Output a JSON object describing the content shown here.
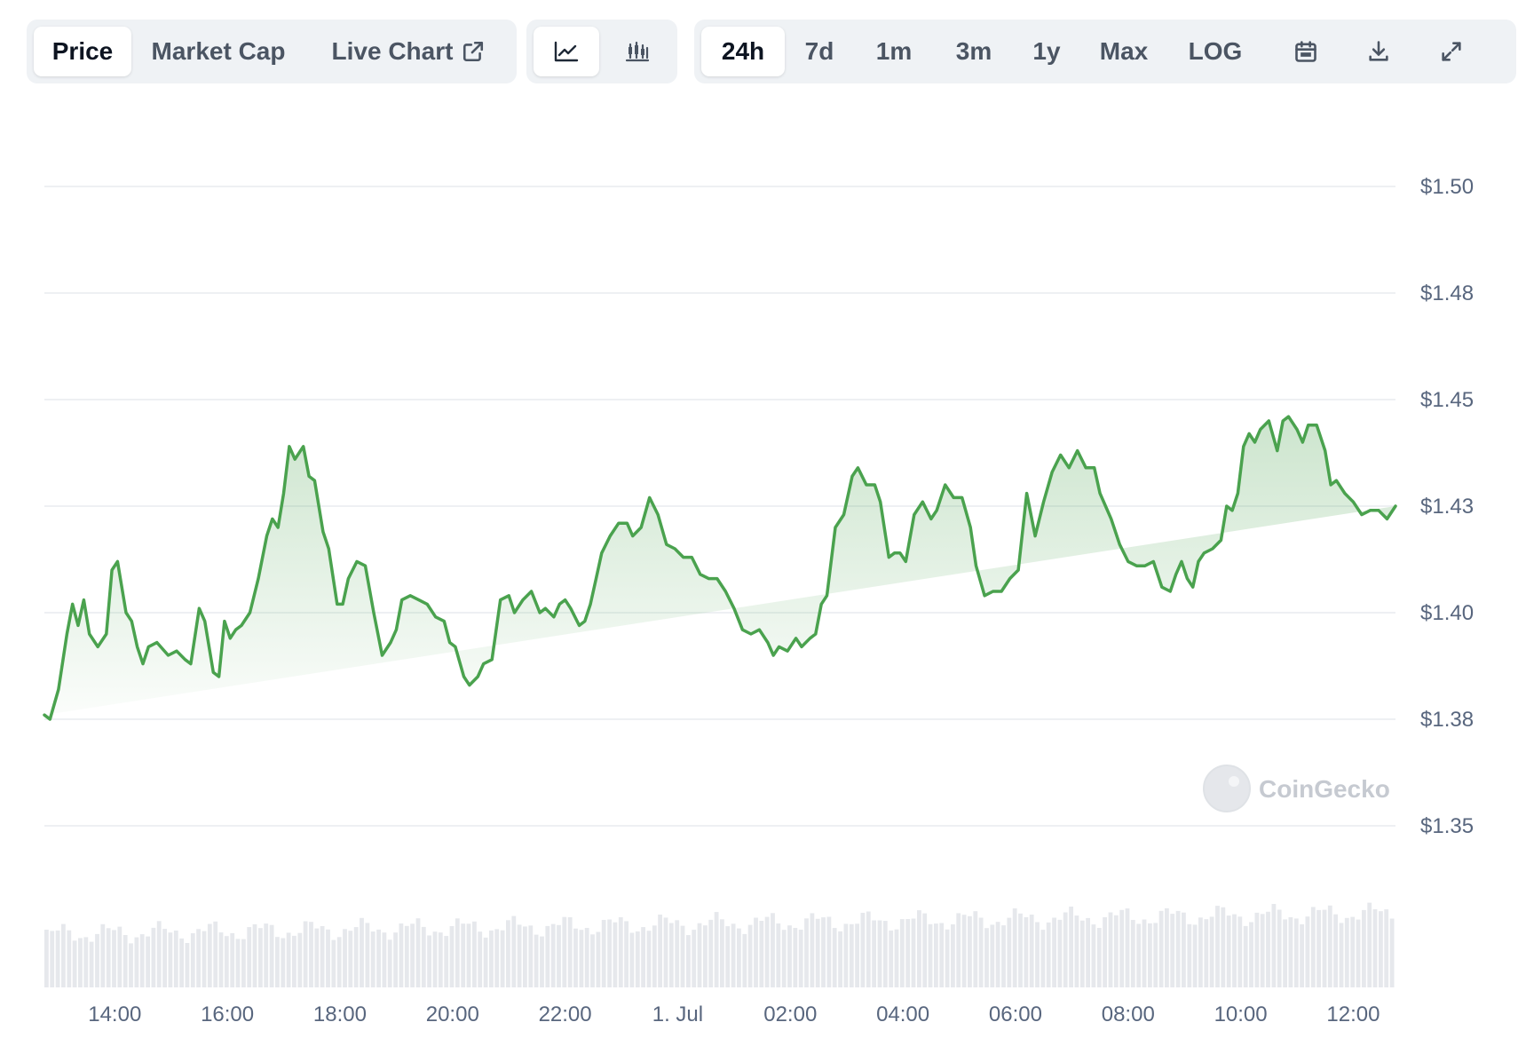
{
  "toolbar": {
    "metric_tabs": [
      "Price",
      "Market Cap",
      "Live Chart"
    ],
    "active_metric": "Price",
    "chart_types": [
      "line-chart-icon",
      "candlestick-icon"
    ],
    "ranges": [
      "24h",
      "7d",
      "1m",
      "3m",
      "1y",
      "Max",
      "LOG"
    ],
    "active_range": "24h",
    "tool_icons": [
      "calendar-icon",
      "download-icon",
      "fullscreen-icon"
    ]
  },
  "watermark": "CoinGecko",
  "colors": {
    "line": "#4aa24e",
    "area_top": "#cfe8cf",
    "active_bg": "#ffffff",
    "toolbar_bg": "#eff2f5",
    "grid": "#e8ecef",
    "volume": "#e6e8ec"
  },
  "chart_data": {
    "type": "area",
    "title": "",
    "y_ticks": [
      "$1.50",
      "$1.48",
      "$1.45",
      "$1.43",
      "$1.40",
      "$1.38",
      "$1.35"
    ],
    "y_tick_values": [
      1.5,
      1.475,
      1.45,
      1.425,
      1.4,
      1.375,
      1.35
    ],
    "ylim": [
      1.35,
      1.5
    ],
    "x_ticks": [
      "14:00",
      "16:00",
      "18:00",
      "20:00",
      "22:00",
      "1. Jul",
      "02:00",
      "04:00",
      "06:00",
      "08:00",
      "10:00",
      "12:00"
    ],
    "x_tick_hours": [
      14,
      16,
      18,
      20,
      22,
      24,
      26,
      28,
      30,
      32,
      34,
      36
    ],
    "xlim_hours": [
      12.75,
      36.75
    ],
    "grid": true,
    "series": [
      {
        "x_hours": [
          12.75,
          12.85,
          13.0,
          13.15,
          13.25,
          13.35,
          13.45,
          13.55,
          13.7,
          13.85,
          13.95,
          14.05,
          14.2,
          14.3,
          14.4,
          14.5,
          14.6,
          14.75,
          14.95,
          15.1,
          15.25,
          15.35,
          15.5,
          15.6,
          15.75,
          15.85,
          15.95,
          16.05,
          16.15,
          16.25,
          16.4,
          16.55,
          16.7,
          16.8,
          16.9,
          17.0,
          17.1,
          17.2,
          17.35,
          17.45,
          17.55,
          17.7,
          17.8,
          17.95,
          18.05,
          18.15,
          18.3,
          18.45,
          18.6,
          18.75,
          18.9,
          19.0,
          19.1,
          19.25,
          19.4,
          19.55,
          19.7,
          19.85,
          19.95,
          20.05,
          20.2,
          20.3,
          20.45,
          20.55,
          20.7,
          20.85,
          21.0,
          21.1,
          21.25,
          21.4,
          21.55,
          21.65,
          21.8,
          21.9,
          22.0,
          22.1,
          22.25,
          22.35,
          22.45,
          22.55,
          22.65,
          22.8,
          22.95,
          23.1,
          23.2,
          23.35,
          23.5,
          23.65,
          23.8,
          23.95,
          24.1,
          24.25,
          24.4,
          24.55,
          24.7,
          24.85,
          25.0,
          25.15,
          25.3,
          25.45,
          25.6,
          25.7,
          25.8,
          25.95,
          26.1,
          26.2,
          26.35,
          26.45,
          26.55,
          26.65,
          26.8,
          26.95,
          27.1,
          27.2,
          27.35,
          27.5,
          27.6,
          27.75,
          27.85,
          27.95,
          28.05,
          28.2,
          28.35,
          28.5,
          28.6,
          28.75,
          28.9,
          29.05,
          29.2,
          29.3,
          29.45,
          29.6,
          29.75,
          29.9,
          30.05,
          30.2,
          30.35,
          30.5,
          30.65,
          30.8,
          30.95,
          31.1,
          31.25,
          31.4,
          31.5,
          31.6,
          31.7,
          31.85,
          32.0,
          32.15,
          32.3,
          32.45,
          32.6,
          32.75,
          32.85,
          32.95,
          33.05,
          33.15,
          33.25,
          33.35,
          33.5,
          33.65,
          33.75,
          33.85,
          33.95,
          34.05,
          34.15,
          34.25,
          34.35,
          34.5,
          34.65,
          34.75,
          34.85,
          35.0,
          35.1,
          35.2,
          35.35,
          35.5,
          35.6,
          35.7,
          35.85,
          36.0,
          36.15,
          36.3,
          36.45,
          36.6,
          36.75
        ],
        "values": [
          1.376,
          1.375,
          1.382,
          1.395,
          1.402,
          1.397,
          1.403,
          1.395,
          1.392,
          1.395,
          1.41,
          1.412,
          1.4,
          1.398,
          1.392,
          1.388,
          1.392,
          1.393,
          1.39,
          1.391,
          1.389,
          1.388,
          1.401,
          1.398,
          1.386,
          1.385,
          1.398,
          1.394,
          1.396,
          1.397,
          1.4,
          1.408,
          1.418,
          1.422,
          1.42,
          1.428,
          1.439,
          1.436,
          1.439,
          1.432,
          1.431,
          1.419,
          1.415,
          1.402,
          1.402,
          1.408,
          1.412,
          1.411,
          1.4,
          1.39,
          1.393,
          1.396,
          1.403,
          1.404,
          1.403,
          1.402,
          1.399,
          1.398,
          1.393,
          1.392,
          1.385,
          1.383,
          1.385,
          1.388,
          1.389,
          1.403,
          1.404,
          1.4,
          1.403,
          1.405,
          1.4,
          1.401,
          1.399,
          1.402,
          1.403,
          1.401,
          1.397,
          1.398,
          1.402,
          1.408,
          1.414,
          1.418,
          1.421,
          1.421,
          1.418,
          1.42,
          1.427,
          1.423,
          1.416,
          1.415,
          1.413,
          1.413,
          1.409,
          1.408,
          1.408,
          1.405,
          1.401,
          1.396,
          1.395,
          1.396,
          1.393,
          1.39,
          1.392,
          1.391,
          1.394,
          1.392,
          1.394,
          1.395,
          1.402,
          1.404,
          1.42,
          1.423,
          1.432,
          1.434,
          1.43,
          1.43,
          1.426,
          1.413,
          1.414,
          1.414,
          1.412,
          1.423,
          1.426,
          1.422,
          1.424,
          1.43,
          1.427,
          1.427,
          1.42,
          1.411,
          1.404,
          1.405,
          1.405,
          1.408,
          1.41,
          1.428,
          1.418,
          1.426,
          1.433,
          1.437,
          1.434,
          1.438,
          1.434,
          1.434,
          1.428,
          1.425,
          1.422,
          1.416,
          1.412,
          1.411,
          1.411,
          1.412,
          1.406,
          1.405,
          1.409,
          1.412,
          1.408,
          1.406,
          1.412,
          1.414,
          1.415,
          1.417,
          1.425,
          1.424,
          1.428,
          1.439,
          1.442,
          1.44,
          1.443,
          1.445,
          1.438,
          1.445,
          1.446,
          1.443,
          1.44,
          1.444,
          1.444,
          1.438,
          1.43,
          1.431,
          1.428,
          1.426,
          1.423,
          1.424,
          1.424,
          1.422,
          1.425,
          1.427,
          1.425,
          1.422,
          1.413
        ]
      }
    ],
    "volume_bars": "decorative relative volume strip along bottom"
  }
}
